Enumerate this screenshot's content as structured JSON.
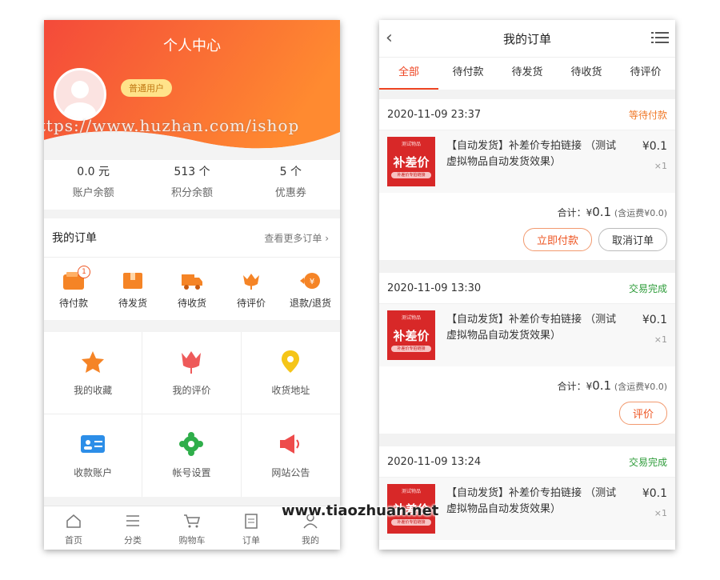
{
  "left": {
    "header_title": "个人中心",
    "user_badge": "普通用户",
    "watermark": "https://www.huzhan.com/ishop",
    "stats": [
      {
        "value": "0.0 元",
        "label": "账户余额"
      },
      {
        "value": "513 个",
        "label": "积分余额"
      },
      {
        "value": "5 个",
        "label": "优惠券"
      }
    ],
    "orders_title": "我的订单",
    "orders_more": "查看更多订单 ›",
    "order_items": [
      {
        "label": "待付款",
        "badge": "1"
      },
      {
        "label": "待发货"
      },
      {
        "label": "待收货"
      },
      {
        "label": "待评价"
      },
      {
        "label": "退款/退货"
      }
    ],
    "grid": [
      {
        "label": "我的收藏",
        "icon": "star-icon"
      },
      {
        "label": "我的评价",
        "icon": "tulip-icon"
      },
      {
        "label": "收货地址",
        "icon": "location-pin-icon"
      },
      {
        "label": "收款账户",
        "icon": "id-card-icon"
      },
      {
        "label": "帐号设置",
        "icon": "gear-icon"
      },
      {
        "label": "网站公告",
        "icon": "megaphone-icon"
      }
    ],
    "tabbar": [
      {
        "label": "首页",
        "icon": "home-icon"
      },
      {
        "label": "分类",
        "icon": "list-icon"
      },
      {
        "label": "购物车",
        "icon": "cart-icon"
      },
      {
        "label": "订单",
        "icon": "clipboard-icon"
      },
      {
        "label": "我的",
        "icon": "user-icon"
      }
    ]
  },
  "right": {
    "nav_title": "我的订单",
    "tabs": [
      "全部",
      "待付款",
      "待发货",
      "待收货",
      "待评价"
    ],
    "orders": [
      {
        "date": "2020-11-09 23:37",
        "status": "等待付款",
        "status_color": "#f07a2a",
        "product": "【自动发货】补差价专拍链接 （测试虚拟物品自动发货效果）",
        "price": "¥0.1",
        "qty": "×1",
        "total_label": "合计：¥",
        "total_value": "0.1",
        "shipping": "(含运费¥0.0)",
        "buttons": [
          "立即付款",
          "取消订单"
        ]
      },
      {
        "date": "2020-11-09 13:30",
        "status": "交易完成",
        "status_color": "#2e9c3a",
        "product": "【自动发货】补差价专拍链接 （测试虚拟物品自动发货效果）",
        "price": "¥0.1",
        "qty": "×1",
        "total_label": "合计：¥",
        "total_value": "0.1",
        "shipping": "(含运费¥0.0)",
        "buttons": [
          "评价"
        ]
      },
      {
        "date": "2020-11-09 13:24",
        "status": "交易完成",
        "status_color": "#2e9c3a",
        "product": "【自动发货】补差价专拍链接 （测试虚拟物品自动发货效果）",
        "price": "¥0.1",
        "qty": "×1"
      }
    ],
    "thumb": {
      "title": "补差价",
      "top_text": "测试物品",
      "bottom_text": "补差价专拍链接"
    },
    "watermark": "www.tiaozhuan.net"
  },
  "colors": {
    "accent": "#ee4422",
    "header_orange": "#ff7a2d",
    "header_red": "#f44a3a"
  }
}
